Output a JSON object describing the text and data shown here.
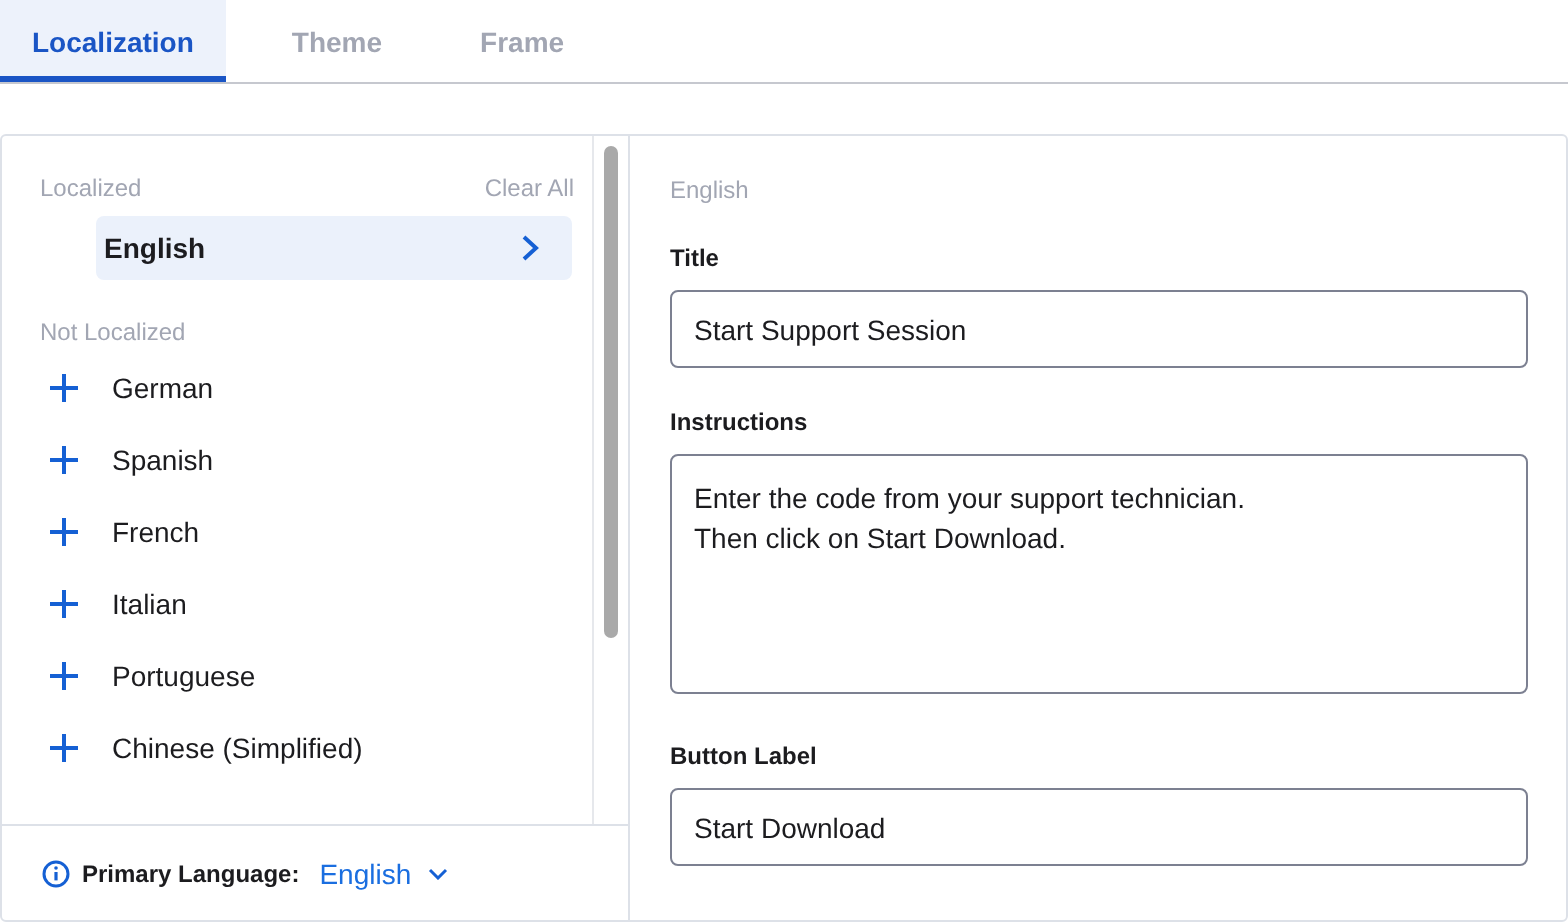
{
  "tabs": [
    {
      "label": "Localization",
      "selected": true
    },
    {
      "label": "Theme",
      "selected": false
    },
    {
      "label": "Frame",
      "selected": false
    }
  ],
  "localized": {
    "heading": "Localized",
    "clear_label": "Clear All",
    "items": [
      {
        "label": "English",
        "selected": true
      }
    ]
  },
  "not_localized": {
    "heading": "Not Localized",
    "items": [
      {
        "label": "German"
      },
      {
        "label": "Spanish"
      },
      {
        "label": "French"
      },
      {
        "label": "Italian"
      },
      {
        "label": "Portuguese"
      },
      {
        "label": "Chinese (Simplified)"
      }
    ]
  },
  "primary_language": {
    "label": "Primary Language:",
    "value": "English"
  },
  "editor": {
    "language": "English",
    "fields": [
      {
        "kind": "line",
        "label": "Title",
        "value": "Start Support Session"
      },
      {
        "kind": "area",
        "label": "Instructions",
        "value": "Enter the code from your support technician.\nThen click on Start Download."
      },
      {
        "kind": "line",
        "label": "Button Label",
        "value": "Start Download"
      }
    ]
  }
}
